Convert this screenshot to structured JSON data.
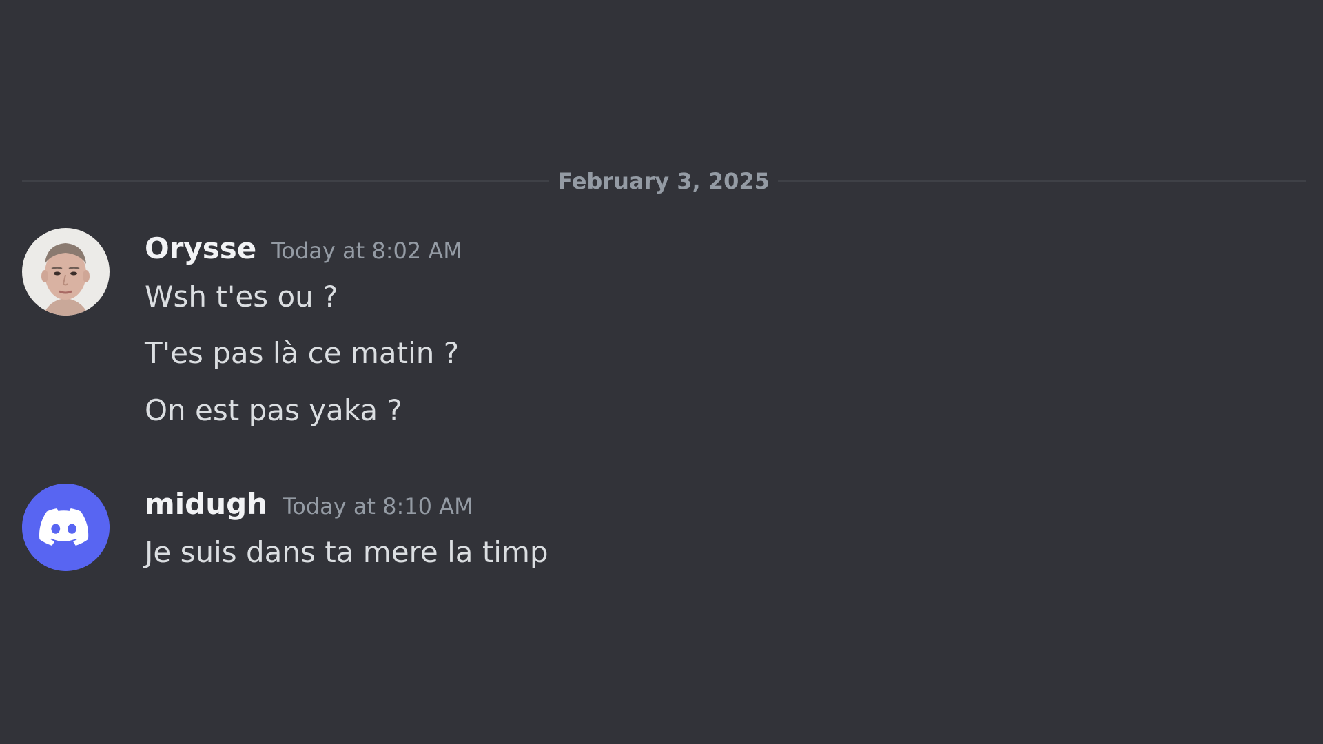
{
  "divider": {
    "date": "February 3, 2025"
  },
  "messages": [
    {
      "author": "Orysse",
      "timestamp": "Today at 8:02 AM",
      "avatar": "user-photo-avatar",
      "lines": [
        "Wsh t'es ou ?",
        "T'es pas là ce matin ?",
        "On est pas yaka ?"
      ]
    },
    {
      "author": "midugh",
      "timestamp": "Today at 8:10 AM",
      "avatar": "discord-default-avatar",
      "lines": [
        "Je suis dans ta mere la timp"
      ]
    }
  ],
  "colors": {
    "background": "#323339",
    "divider": "#3f4147",
    "username": "#f2f3f5",
    "timestamp": "#949ba4",
    "message_text": "#dbdee1",
    "discord_blurple": "#5865f2"
  }
}
